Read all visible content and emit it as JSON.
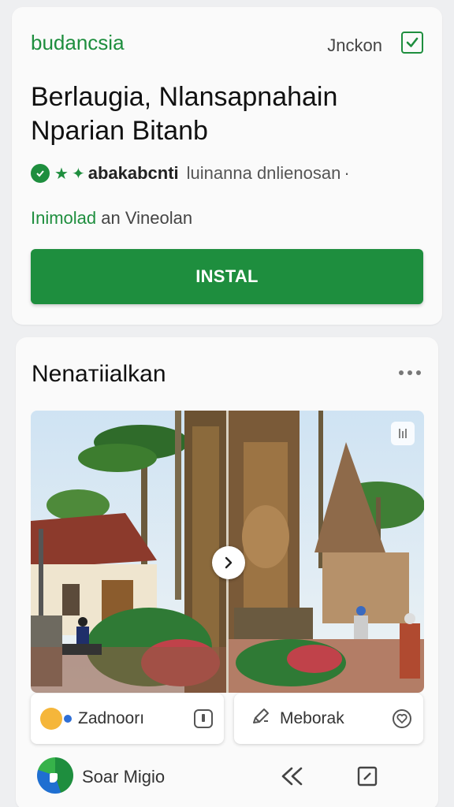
{
  "header": {
    "brand": "budancsia",
    "language_link": "Jnckon"
  },
  "app": {
    "title": "Berlaugia, Nlansapnahain Nparian Bitanb",
    "developer": "abakabcnti",
    "developer_subtitle": "luinanna dnlienosan",
    "in_app_label_green": "Inimolad",
    "in_app_label_rest": "an Vineolan",
    "install_label": "INSTAL"
  },
  "section": {
    "title": "Nenaтiialkan"
  },
  "chips": [
    {
      "label": "Zadnoorı",
      "icon": "emoji-avatar-icon",
      "trailing_icon": "info-icon"
    },
    {
      "label": "Meborak",
      "icon": "pencil-icon",
      "trailing_icon": "heart-icon"
    }
  ],
  "bottom_bar": {
    "app_name": "Soar Migio"
  },
  "colors": {
    "accent": "#1e8e3e",
    "card": "#fafafa",
    "background": "#eeeff1"
  }
}
